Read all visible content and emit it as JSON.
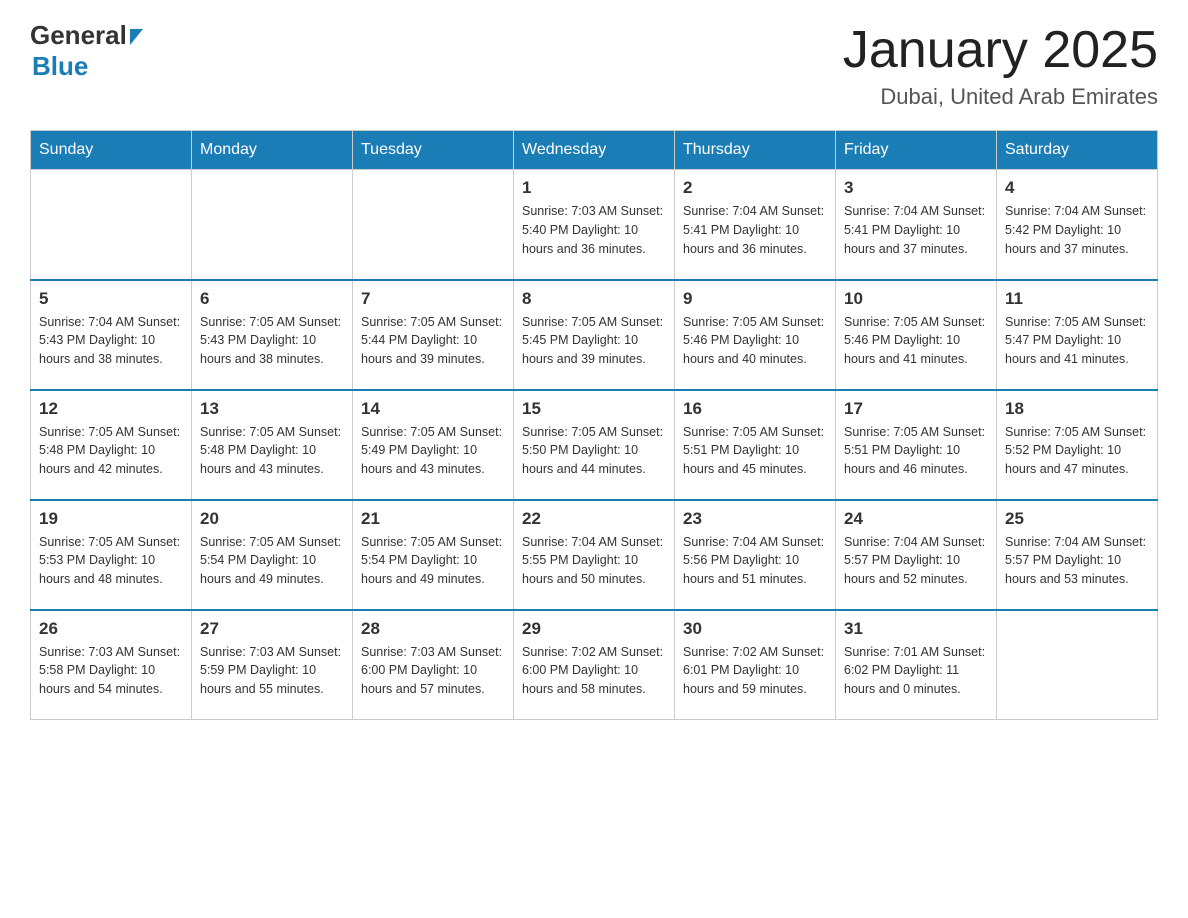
{
  "header": {
    "logo_general": "General",
    "logo_blue": "Blue",
    "title": "January 2025",
    "subtitle": "Dubai, United Arab Emirates"
  },
  "days_of_week": [
    "Sunday",
    "Monday",
    "Tuesday",
    "Wednesday",
    "Thursday",
    "Friday",
    "Saturday"
  ],
  "weeks": [
    [
      {
        "day": "",
        "info": ""
      },
      {
        "day": "",
        "info": ""
      },
      {
        "day": "",
        "info": ""
      },
      {
        "day": "1",
        "info": "Sunrise: 7:03 AM\nSunset: 5:40 PM\nDaylight: 10 hours\nand 36 minutes."
      },
      {
        "day": "2",
        "info": "Sunrise: 7:04 AM\nSunset: 5:41 PM\nDaylight: 10 hours\nand 36 minutes."
      },
      {
        "day": "3",
        "info": "Sunrise: 7:04 AM\nSunset: 5:41 PM\nDaylight: 10 hours\nand 37 minutes."
      },
      {
        "day": "4",
        "info": "Sunrise: 7:04 AM\nSunset: 5:42 PM\nDaylight: 10 hours\nand 37 minutes."
      }
    ],
    [
      {
        "day": "5",
        "info": "Sunrise: 7:04 AM\nSunset: 5:43 PM\nDaylight: 10 hours\nand 38 minutes."
      },
      {
        "day": "6",
        "info": "Sunrise: 7:05 AM\nSunset: 5:43 PM\nDaylight: 10 hours\nand 38 minutes."
      },
      {
        "day": "7",
        "info": "Sunrise: 7:05 AM\nSunset: 5:44 PM\nDaylight: 10 hours\nand 39 minutes."
      },
      {
        "day": "8",
        "info": "Sunrise: 7:05 AM\nSunset: 5:45 PM\nDaylight: 10 hours\nand 39 minutes."
      },
      {
        "day": "9",
        "info": "Sunrise: 7:05 AM\nSunset: 5:46 PM\nDaylight: 10 hours\nand 40 minutes."
      },
      {
        "day": "10",
        "info": "Sunrise: 7:05 AM\nSunset: 5:46 PM\nDaylight: 10 hours\nand 41 minutes."
      },
      {
        "day": "11",
        "info": "Sunrise: 7:05 AM\nSunset: 5:47 PM\nDaylight: 10 hours\nand 41 minutes."
      }
    ],
    [
      {
        "day": "12",
        "info": "Sunrise: 7:05 AM\nSunset: 5:48 PM\nDaylight: 10 hours\nand 42 minutes."
      },
      {
        "day": "13",
        "info": "Sunrise: 7:05 AM\nSunset: 5:48 PM\nDaylight: 10 hours\nand 43 minutes."
      },
      {
        "day": "14",
        "info": "Sunrise: 7:05 AM\nSunset: 5:49 PM\nDaylight: 10 hours\nand 43 minutes."
      },
      {
        "day": "15",
        "info": "Sunrise: 7:05 AM\nSunset: 5:50 PM\nDaylight: 10 hours\nand 44 minutes."
      },
      {
        "day": "16",
        "info": "Sunrise: 7:05 AM\nSunset: 5:51 PM\nDaylight: 10 hours\nand 45 minutes."
      },
      {
        "day": "17",
        "info": "Sunrise: 7:05 AM\nSunset: 5:51 PM\nDaylight: 10 hours\nand 46 minutes."
      },
      {
        "day": "18",
        "info": "Sunrise: 7:05 AM\nSunset: 5:52 PM\nDaylight: 10 hours\nand 47 minutes."
      }
    ],
    [
      {
        "day": "19",
        "info": "Sunrise: 7:05 AM\nSunset: 5:53 PM\nDaylight: 10 hours\nand 48 minutes."
      },
      {
        "day": "20",
        "info": "Sunrise: 7:05 AM\nSunset: 5:54 PM\nDaylight: 10 hours\nand 49 minutes."
      },
      {
        "day": "21",
        "info": "Sunrise: 7:05 AM\nSunset: 5:54 PM\nDaylight: 10 hours\nand 49 minutes."
      },
      {
        "day": "22",
        "info": "Sunrise: 7:04 AM\nSunset: 5:55 PM\nDaylight: 10 hours\nand 50 minutes."
      },
      {
        "day": "23",
        "info": "Sunrise: 7:04 AM\nSunset: 5:56 PM\nDaylight: 10 hours\nand 51 minutes."
      },
      {
        "day": "24",
        "info": "Sunrise: 7:04 AM\nSunset: 5:57 PM\nDaylight: 10 hours\nand 52 minutes."
      },
      {
        "day": "25",
        "info": "Sunrise: 7:04 AM\nSunset: 5:57 PM\nDaylight: 10 hours\nand 53 minutes."
      }
    ],
    [
      {
        "day": "26",
        "info": "Sunrise: 7:03 AM\nSunset: 5:58 PM\nDaylight: 10 hours\nand 54 minutes."
      },
      {
        "day": "27",
        "info": "Sunrise: 7:03 AM\nSunset: 5:59 PM\nDaylight: 10 hours\nand 55 minutes."
      },
      {
        "day": "28",
        "info": "Sunrise: 7:03 AM\nSunset: 6:00 PM\nDaylight: 10 hours\nand 57 minutes."
      },
      {
        "day": "29",
        "info": "Sunrise: 7:02 AM\nSunset: 6:00 PM\nDaylight: 10 hours\nand 58 minutes."
      },
      {
        "day": "30",
        "info": "Sunrise: 7:02 AM\nSunset: 6:01 PM\nDaylight: 10 hours\nand 59 minutes."
      },
      {
        "day": "31",
        "info": "Sunrise: 7:01 AM\nSunset: 6:02 PM\nDaylight: 11 hours\nand 0 minutes."
      },
      {
        "day": "",
        "info": ""
      }
    ]
  ]
}
